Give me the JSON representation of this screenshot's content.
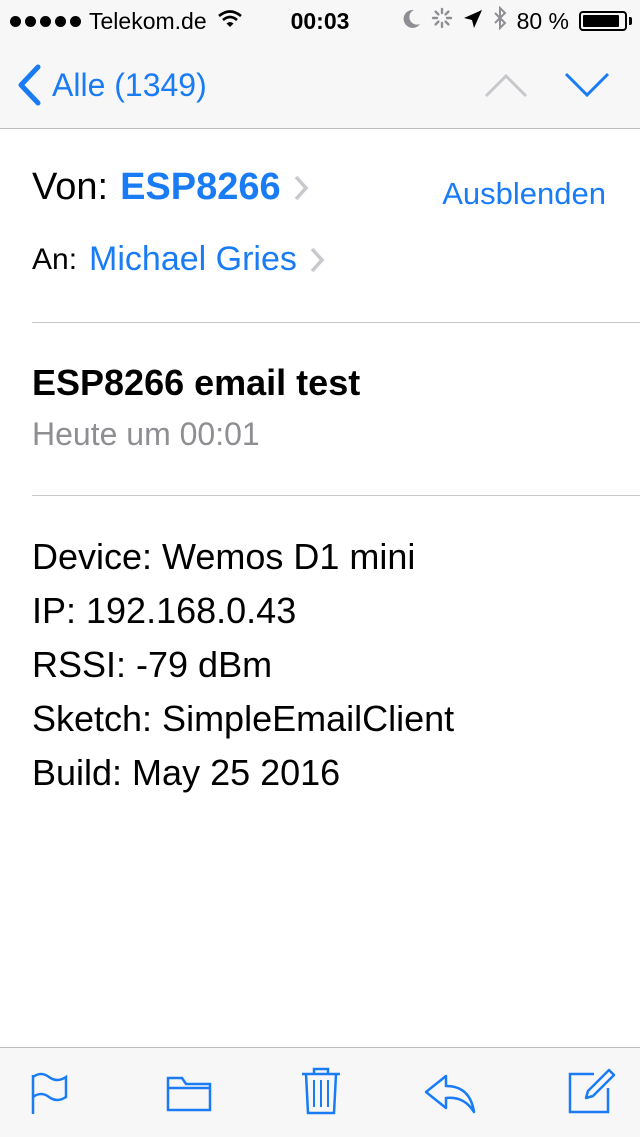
{
  "status_bar": {
    "carrier": "Telekom.de",
    "time": "00:03",
    "battery": "80 %",
    "icons": [
      "signal-dots-icon",
      "wifi-icon",
      "moon-icon",
      "activity-spinner-icon",
      "location-arrow-icon",
      "bluetooth-icon",
      "battery-icon"
    ]
  },
  "nav": {
    "back_label": "Alle (1349)",
    "icons": [
      "chevron-left-icon",
      "chevron-up-icon",
      "chevron-down-icon"
    ]
  },
  "header": {
    "from_label": "Von:",
    "from_name": "ESP8266",
    "hide_label": "Ausblenden",
    "to_label": "An:",
    "to_name": "Michael Gries"
  },
  "message": {
    "subject": "ESP8266 email test",
    "date": "Heute um 00:01",
    "body": [
      "Device: Wemos D1 mini",
      "IP: 192.168.0.43",
      "RSSI: -79 dBm",
      "Sketch: SimpleEmailClient",
      "Build: May 25 2016"
    ]
  },
  "toolbar": {
    "icons": [
      "flag-icon",
      "folder-icon",
      "trash-icon",
      "reply-icon",
      "compose-icon"
    ]
  },
  "colors": {
    "accent": "#1a7cf5",
    "secondary_text": "#8e8e93",
    "bar_background": "#f7f7f7",
    "separator": "#c8c7cc"
  }
}
